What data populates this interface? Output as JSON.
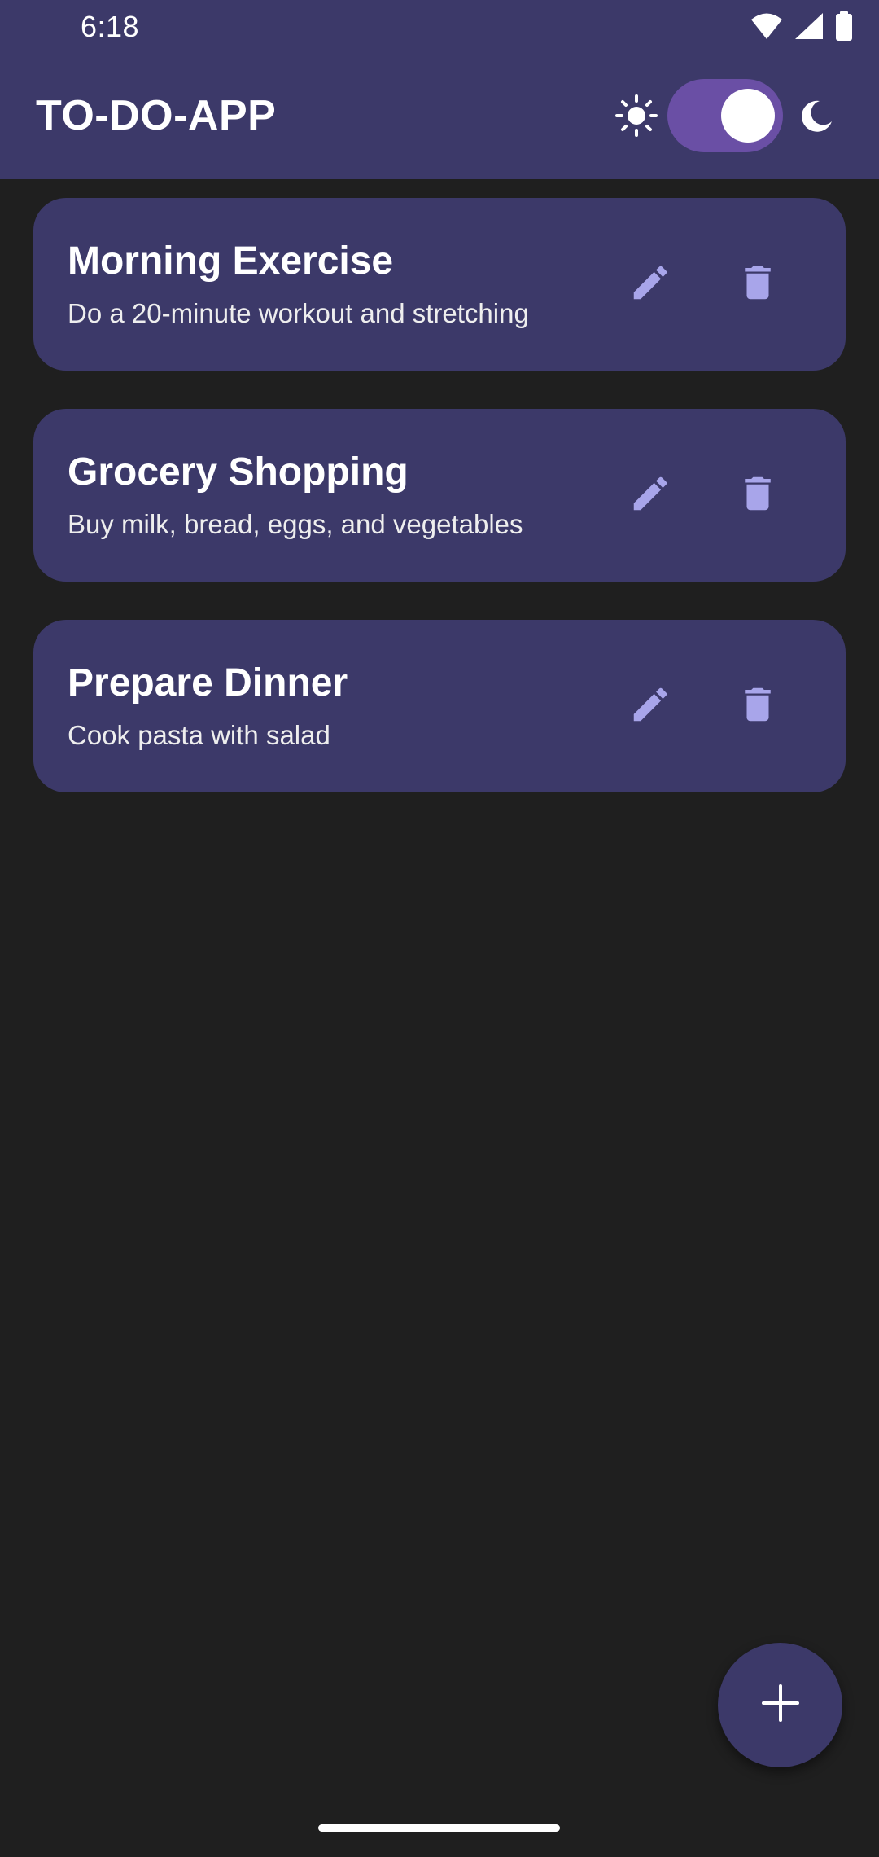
{
  "status_bar": {
    "time": "6:18",
    "icons": [
      "wifi-icon",
      "signal-icon",
      "battery-icon"
    ]
  },
  "app_bar": {
    "title": "TO-DO-APP",
    "theme_toggle": {
      "left_icon": "sun-icon",
      "right_icon": "moon-icon",
      "dark_mode_on": true
    }
  },
  "tasks": [
    {
      "title": "Morning Exercise",
      "description": "Do a 20-minute workout and stretching"
    },
    {
      "title": "Grocery Shopping",
      "description": "Buy milk, bread, eggs, and vegetables"
    },
    {
      "title": "Prepare Dinner",
      "description": "Cook pasta with salad"
    }
  ],
  "task_actions": {
    "edit_icon": "pencil-icon",
    "delete_icon": "trash-icon"
  },
  "fab": {
    "icon": "plus-icon"
  },
  "colors": {
    "background": "#1f1f1f",
    "surface": "#3c3969",
    "toggle_track": "#6a4fa5",
    "icon_accent": "#a8a5ea",
    "text": "#ffffff"
  }
}
